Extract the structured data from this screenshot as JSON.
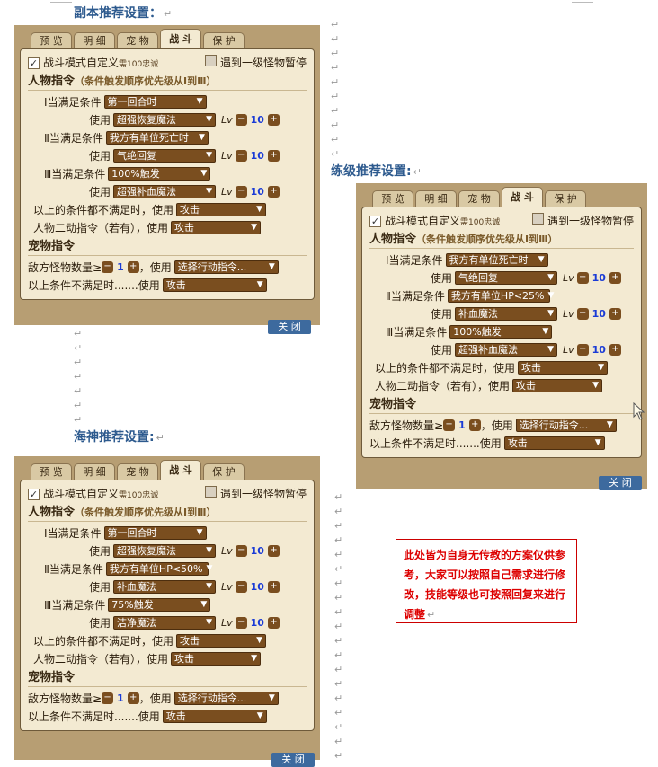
{
  "headings": {
    "dungeon": "副本推荐设置：",
    "leveling": "练级推荐设置:",
    "seagod": "海神推荐设置:"
  },
  "return_mark": "↵",
  "tabs": [
    "预 览",
    "明 细",
    "宠 物",
    "战 斗",
    "保 护"
  ],
  "common": {
    "custom_label": "战斗模式自定义",
    "custom_note": "需100忠诚",
    "pause_label": "遇到一级怪物暂停",
    "char_section": "人物指令",
    "char_section_sub": "（条件触发顺序优先级从Ⅰ到Ⅲ）",
    "cond1": "Ⅰ当满足条件",
    "cond2": "Ⅱ当满足条件",
    "cond3": "Ⅲ当满足条件",
    "use": "使用",
    "lv": "Lv",
    "minus": "−",
    "plus": "+",
    "fallback_label": "以上的条件都不满足时，使用",
    "second_label": "人物二动指令（若有），使用",
    "attack": "攻击",
    "pet_section": "宠物指令",
    "pet_count_label": "敌方怪物数量≥",
    "pet_use": "，使用",
    "pet_count": "1",
    "pet_action": "选择行动指令...",
    "pet_else": "以上条件不满足时.......使用",
    "close": "关 闭"
  },
  "panels": {
    "dungeon": {
      "c1": "第一回合时",
      "s1": "超强恢复魔法",
      "lv1": "10",
      "c2": "我方有单位死亡时",
      "s2": "气绝回复",
      "lv2": "10",
      "c3": "100%触发",
      "s3": "超强补血魔法",
      "lv3": "10"
    },
    "leveling": {
      "c1": "我方有单位死亡时",
      "s1": "气绝回复",
      "lv1": "10",
      "c2": "我方有单位HP<25%",
      "s2": "补血魔法",
      "lv2": "10",
      "c3": "100%触发",
      "s3": "超强补血魔法",
      "lv3": "10"
    },
    "seagod": {
      "c1": "第一回合时",
      "s1": "超强恢复魔法",
      "lv1": "10",
      "c2": "我方有单位HP<50%",
      "s2": "补血魔法",
      "lv2": "10",
      "c3": "75%触发",
      "s3": "洁净魔法",
      "lv3": "10"
    }
  },
  "note": "此处皆为自身无传教的方案仅供参考，大家可以按照自己需求进行修改，技能等级也可按照回复来进行调整"
}
